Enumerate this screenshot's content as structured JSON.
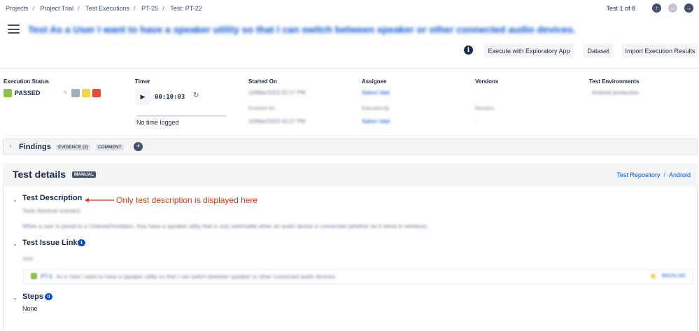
{
  "breadcrumb": [
    "Projects",
    "Project Trial",
    "Test Executions",
    "PT-25",
    "Test: PT-22"
  ],
  "nav": {
    "position": "Test 1 of 8",
    "up_icon": "arrow-up-icon",
    "back_icon": "arrow-left-icon",
    "next_icon": "arrow-right-icon"
  },
  "page_title": "Test As a User I want to have a speaker utility so that I can switch between speaker or other connected audio devices.",
  "toolbar": {
    "info_icon": "info-icon",
    "execute_label": "Execute with Exploratory App",
    "dataset_label": "Dataset",
    "import_label": "Import Execution Results"
  },
  "execution": {
    "status_header": "Execution Status",
    "status": "PASSED",
    "status_color": "#8bc34a",
    "swatch_colors": [
      "#a5adba",
      "#f5d547",
      "#e5493a"
    ],
    "timer_header": "Timer",
    "timer_value": "00:10:03",
    "timer_note": "No time logged",
    "started_header": "Started On",
    "started_value": "10/Mar/2023 02:17 PM",
    "finished_header": "Finished On",
    "finished_value": "10/Mar/2023 02:27 PM",
    "assignee_header": "Assignee",
    "assignee_value": "Saloni Vaid",
    "executed_header": "Executed By",
    "executed_value": "Saloni Vaid",
    "versions_header": "Versions",
    "versions_value": "-",
    "revision_header": "Revision",
    "revision_value": "-",
    "env_header": "Test Environments",
    "env_value": "Android production"
  },
  "findings": {
    "label": "Findings",
    "evidence_label": "EVIDENCE (2)",
    "comment_label": "COMMENT"
  },
  "details": {
    "title": "Test details",
    "type_badge": "MANUAL",
    "repo_link": "Test Repository",
    "folder_link": "Android",
    "description_title": "Test Description",
    "annotation": "Only test description is displayed here",
    "description_summary": "Tests Nominal scenario.",
    "description_body": "When a user is joined to a Channel/Invitation, they have a speaker utility that is only switchable when an audio device is connected (whether be it wired or wireless).",
    "issue_links_title": "Test Issue Links",
    "issue_links_count": "1",
    "issue_links_relation": "tests",
    "issue_link_key": "PT-5",
    "issue_link_text": "As a User I want to have a speaker utility so that I can switch between speaker or other connected audio devices.",
    "issue_link_status": "BACKLOG",
    "steps_title": "Steps",
    "steps_count": "0",
    "steps_none": "None"
  }
}
